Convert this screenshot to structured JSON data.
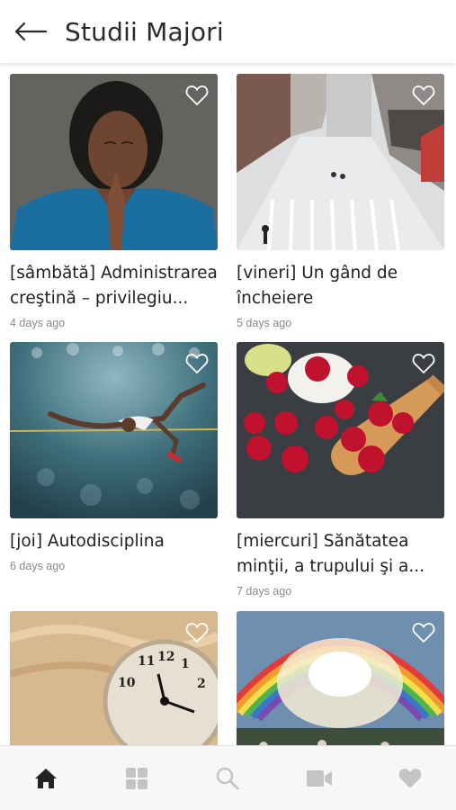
{
  "header": {
    "title": "Studii Majori"
  },
  "articles": [
    {
      "title": "[sâmbătă] Administrarea creştină –  privilegiu...",
      "time": "4 days ago"
    },
    {
      "title": "[vineri] Un gând de încheiere",
      "time": "5 days ago"
    },
    {
      "title": "[joi] Autodisciplina",
      "time": "6 days ago"
    },
    {
      "title": "[miercuri] Sănătatea minţii, a trupului şi a...",
      "time": "7 days ago"
    },
    {
      "title": "",
      "time": ""
    },
    {
      "title": "",
      "time": ""
    }
  ],
  "colors": {
    "accent": "#222222",
    "inactive": "#c4c4c4",
    "time": "#8a8a8a"
  },
  "tabs": [
    {
      "icon": "home-icon",
      "active": true
    },
    {
      "icon": "grid-icon",
      "active": false
    },
    {
      "icon": "search-icon",
      "active": false
    },
    {
      "icon": "video-icon",
      "active": false
    },
    {
      "icon": "heart-icon",
      "active": false
    }
  ]
}
